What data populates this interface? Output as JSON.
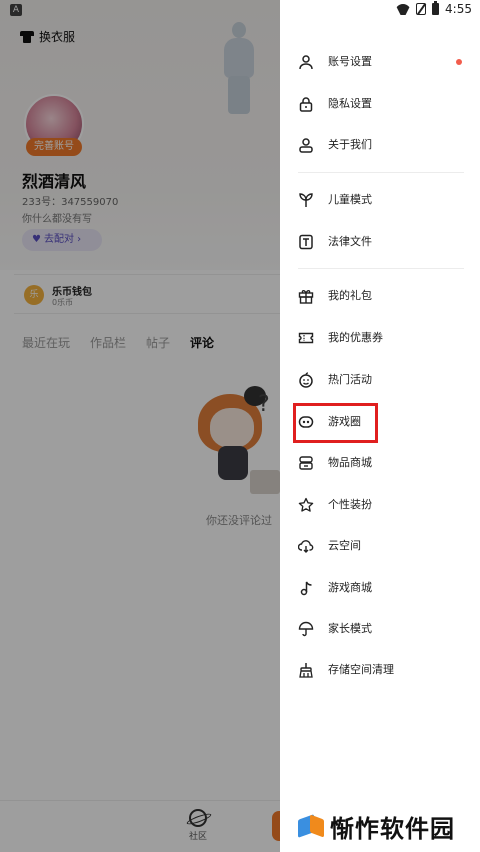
{
  "status_bar": {
    "time": "4:55",
    "left_badge": "A"
  },
  "profile": {
    "wardrobe_label": "换衣服",
    "avatar_badge": "完善账号",
    "username": "烈酒清风",
    "user_id": "233号：347559070",
    "signature": "你什么都没有写",
    "match_button": "去配对 ›",
    "wallet_title": "乐币钱包",
    "wallet_sub": "0乐币",
    "coin_glyph": "乐",
    "tabs": [
      "最近在玩",
      "作品栏",
      "帖子",
      "评论"
    ],
    "active_tab": "评论",
    "empty_text": "你还没评论过",
    "bottom_nav": {
      "community": "社区"
    }
  },
  "drawer": {
    "items": [
      {
        "label": "账号设置",
        "icon": "person-icon",
        "has_dot": true
      },
      {
        "label": "隐私设置",
        "icon": "lock-icon",
        "has_dot": false
      },
      {
        "label": "关于我们",
        "icon": "user-outline-icon",
        "has_dot": false
      },
      {
        "label": "儿童模式",
        "icon": "sprout-icon",
        "has_dot": false
      },
      {
        "label": "法律文件",
        "icon": "document-t-icon",
        "has_dot": false
      },
      {
        "label": "我的礼包",
        "icon": "gift-icon",
        "has_dot": false
      },
      {
        "label": "我的优惠券",
        "icon": "coupon-icon",
        "has_dot": false
      },
      {
        "label": "热门活动",
        "icon": "smiley-icon",
        "has_dot": false
      },
      {
        "label": "游戏圈",
        "icon": "game-circle-icon",
        "has_dot": false,
        "highlighted": true
      },
      {
        "label": "物品商城",
        "icon": "store-icon",
        "has_dot": false
      },
      {
        "label": "个性装扮",
        "icon": "star-outline-icon",
        "has_dot": false
      },
      {
        "label": "云空间",
        "icon": "cloud-download-icon",
        "has_dot": false
      },
      {
        "label": "游戏商城",
        "icon": "music-note-icon",
        "has_dot": false
      },
      {
        "label": "家长模式",
        "icon": "umbrella-icon",
        "has_dot": false
      },
      {
        "label": "存储空间清理",
        "icon": "broom-icon",
        "has_dot": false
      }
    ]
  },
  "colors": {
    "accent_orange": "#f07a2a",
    "notification_dot": "#f25c4c",
    "highlight_red": "#e01f1f",
    "match_purple": "#5a4ec2"
  },
  "watermark": {
    "text": "惭怍软件园"
  }
}
